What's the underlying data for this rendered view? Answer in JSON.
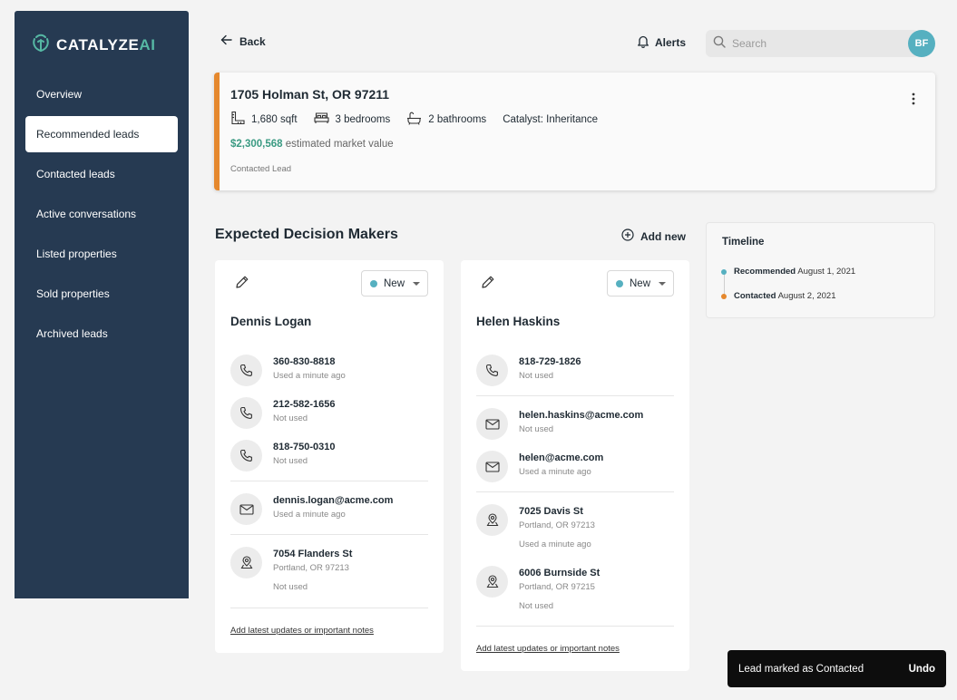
{
  "brand": {
    "name_main": "CATALYZE",
    "name_accent": "AI",
    "accent": "#56b8a4"
  },
  "sidebar": {
    "items": [
      {
        "label": "Overview"
      },
      {
        "label": "Recommended leads",
        "active": true
      },
      {
        "label": "Contacted leads"
      },
      {
        "label": "Active conversations"
      },
      {
        "label": "Listed properties"
      },
      {
        "label": "Sold properties"
      },
      {
        "label": "Archived leads"
      }
    ]
  },
  "header": {
    "back_label": "Back",
    "alerts_label": "Alerts",
    "search_placeholder": "Search",
    "avatar_initials": "BF"
  },
  "property": {
    "address": "1705 Holman St, OR 97211",
    "sqft": "1,680 sqft",
    "bedrooms": "3 bedrooms",
    "bathrooms": "2 bathrooms",
    "catalyst": "Catalyst: Inheritance",
    "value": "$2,300,568",
    "value_suffix": "estimated market value",
    "status": "Contacted Lead",
    "accent": "#e5882d"
  },
  "decision_makers": {
    "title": "Expected Decision Makers",
    "add_label": "Add new",
    "people": [
      {
        "name": "Dennis Logan",
        "status": "New",
        "phones": [
          {
            "value": "360-830-8818",
            "usage": "Used a minute ago"
          },
          {
            "value": "212-582-1656",
            "usage": "Not used"
          },
          {
            "value": "818-750-0310",
            "usage": "Not used"
          }
        ],
        "emails": [
          {
            "value": "dennis.logan@acme.com",
            "usage": "Used a minute ago"
          }
        ],
        "addresses": [
          {
            "street": "7054 Flanders St",
            "city": "Portland, OR 97213",
            "usage": "Not used"
          }
        ],
        "notes_label": "Add latest updates or important notes"
      },
      {
        "name": "Helen Haskins",
        "status": "New",
        "phones": [
          {
            "value": "818-729-1826",
            "usage": "Not used"
          }
        ],
        "emails": [
          {
            "value": "helen.haskins@acme.com",
            "usage": "Not used"
          },
          {
            "value": "helen@acme.com",
            "usage": "Used a minute ago"
          }
        ],
        "addresses": [
          {
            "street": "7025 Davis St",
            "city": "Portland, OR 97213",
            "usage": "Used a minute ago"
          },
          {
            "street": "6006 Burnside St",
            "city": "Portland, OR 97215",
            "usage": "Not used"
          }
        ],
        "notes_label": "Add latest updates or important notes"
      }
    ]
  },
  "timeline": {
    "title": "Timeline",
    "events": [
      {
        "label": "Recommended",
        "date": "August 1, 2021",
        "color": "#56b0c0"
      },
      {
        "label": "Contacted",
        "date": "August 2, 2021",
        "color": "#e5882d"
      }
    ]
  },
  "toast": {
    "message": "Lead marked as Contacted",
    "action": "Undo"
  },
  "icons": {
    "phone": "phone-icon",
    "email": "mail-icon",
    "address": "location-pin-icon",
    "sqft": "ruler-icon",
    "bed": "bed-icon",
    "bath": "bathtub-icon"
  }
}
